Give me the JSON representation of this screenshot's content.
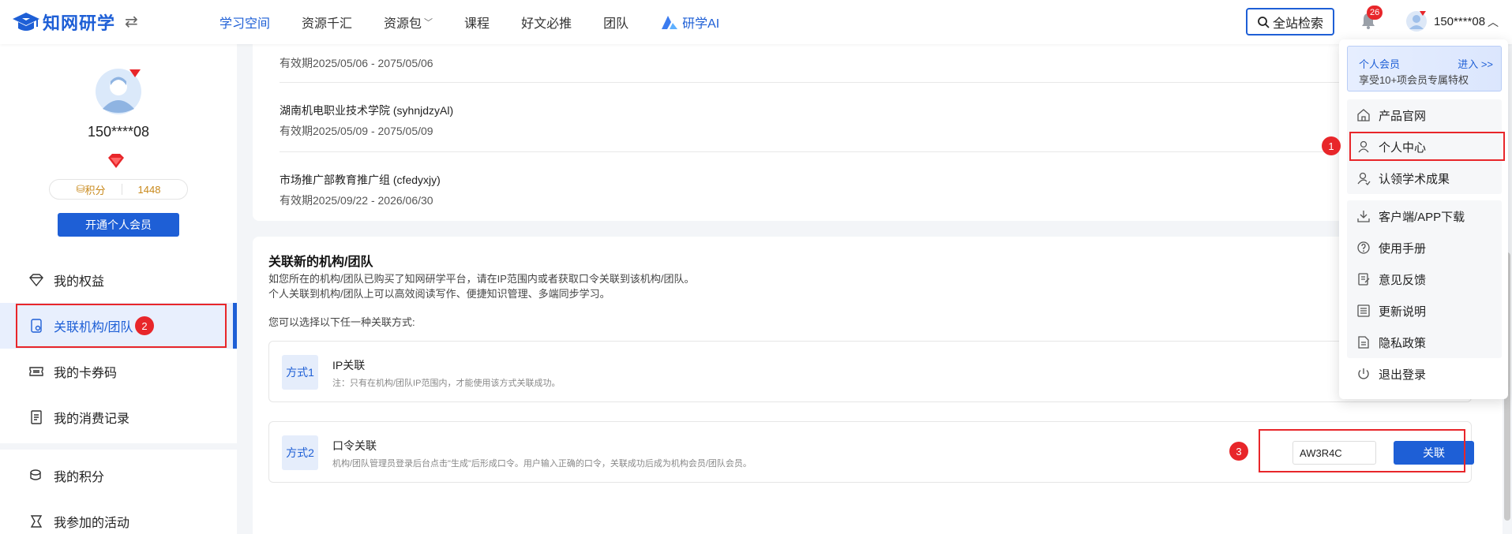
{
  "header": {
    "logo_text": "知网研学",
    "nav": [
      {
        "label": "学习空间",
        "active": true
      },
      {
        "label": "资源千汇"
      },
      {
        "label": "资源包",
        "has_dropdown": true
      },
      {
        "label": "课程"
      },
      {
        "label": "好文必推"
      },
      {
        "label": "团队"
      },
      {
        "label": "研学AI"
      }
    ],
    "search_label": "全站检索",
    "notification_count": "26",
    "username": "150****08"
  },
  "sidebar": {
    "username": "150****08",
    "points_label": "积分",
    "points_value": "1448",
    "member_button": "开通个人会员",
    "menu": [
      {
        "label": "我的权益",
        "icon": "diamond-icon"
      },
      {
        "label": "关联机构/团队",
        "icon": "link-document-icon",
        "active": true
      },
      {
        "label": "我的卡券码",
        "icon": "ticket-icon"
      },
      {
        "label": "我的消费记录",
        "icon": "receipt-icon"
      },
      {
        "label": "我的积分",
        "icon": "coins-icon"
      },
      {
        "label": "我参加的活动",
        "icon": "activity-icon"
      }
    ]
  },
  "orgs": [
    {
      "name": "",
      "validity": "有效期2025/05/06 - 2075/05/06"
    },
    {
      "name": "湖南机电职业技术学院 (syhnjdzyAl)",
      "validity": "有效期2025/05/09 - 2075/05/09"
    },
    {
      "name": "市场推广部教育推广组 (cfedyxjy)",
      "validity": "有效期2025/09/22 - 2026/06/30"
    }
  ],
  "link_section": {
    "title": "关联新的机构/团队",
    "desc_line1": "如您所在的机构/团队已购买了知网研学平台，请在IP范围内或者获取口令关联到该机构/团队。",
    "desc_line2": "个人关联到机构/团队上可以高效阅读写作、便捷知识管理、多端同步学习。",
    "choose": "您可以选择以下任一种关联方式:",
    "method1": {
      "tag": "方式1",
      "name": "IP关联",
      "note": "注：只有在机构/团队IP范围内，才能使用该方式关联成功。"
    },
    "method2": {
      "tag": "方式2",
      "name": "口令关联",
      "note": "机构/团队管理员登录后台点击\"生成\"后形成口令。用户输入正确的口令，关联成功后成为机构会员/团队会员。",
      "code_value": "AW3R4C",
      "button": "关联"
    }
  },
  "dropdown": {
    "member_title": "个人会员",
    "member_enter": "进入 >>",
    "member_sub": "享受10+项会员专属特权",
    "group1": [
      {
        "label": "产品官网",
        "icon": "home-icon"
      },
      {
        "label": "个人中心",
        "icon": "user-icon"
      },
      {
        "label": "认领学术成果",
        "icon": "user-claim-icon"
      }
    ],
    "group2": [
      {
        "label": "客户端/APP下载",
        "icon": "download-icon"
      },
      {
        "label": "使用手册",
        "icon": "help-icon"
      },
      {
        "label": "意见反馈",
        "icon": "feedback-icon"
      },
      {
        "label": "更新说明",
        "icon": "list-icon"
      },
      {
        "label": "隐私政策",
        "icon": "document-icon"
      }
    ],
    "logout": "退出登录"
  },
  "annotations": [
    "1",
    "2",
    "3"
  ],
  "colors": {
    "brand": "#1e5fd6",
    "annotation_red": "#e8262a",
    "points": "#c8881a"
  }
}
